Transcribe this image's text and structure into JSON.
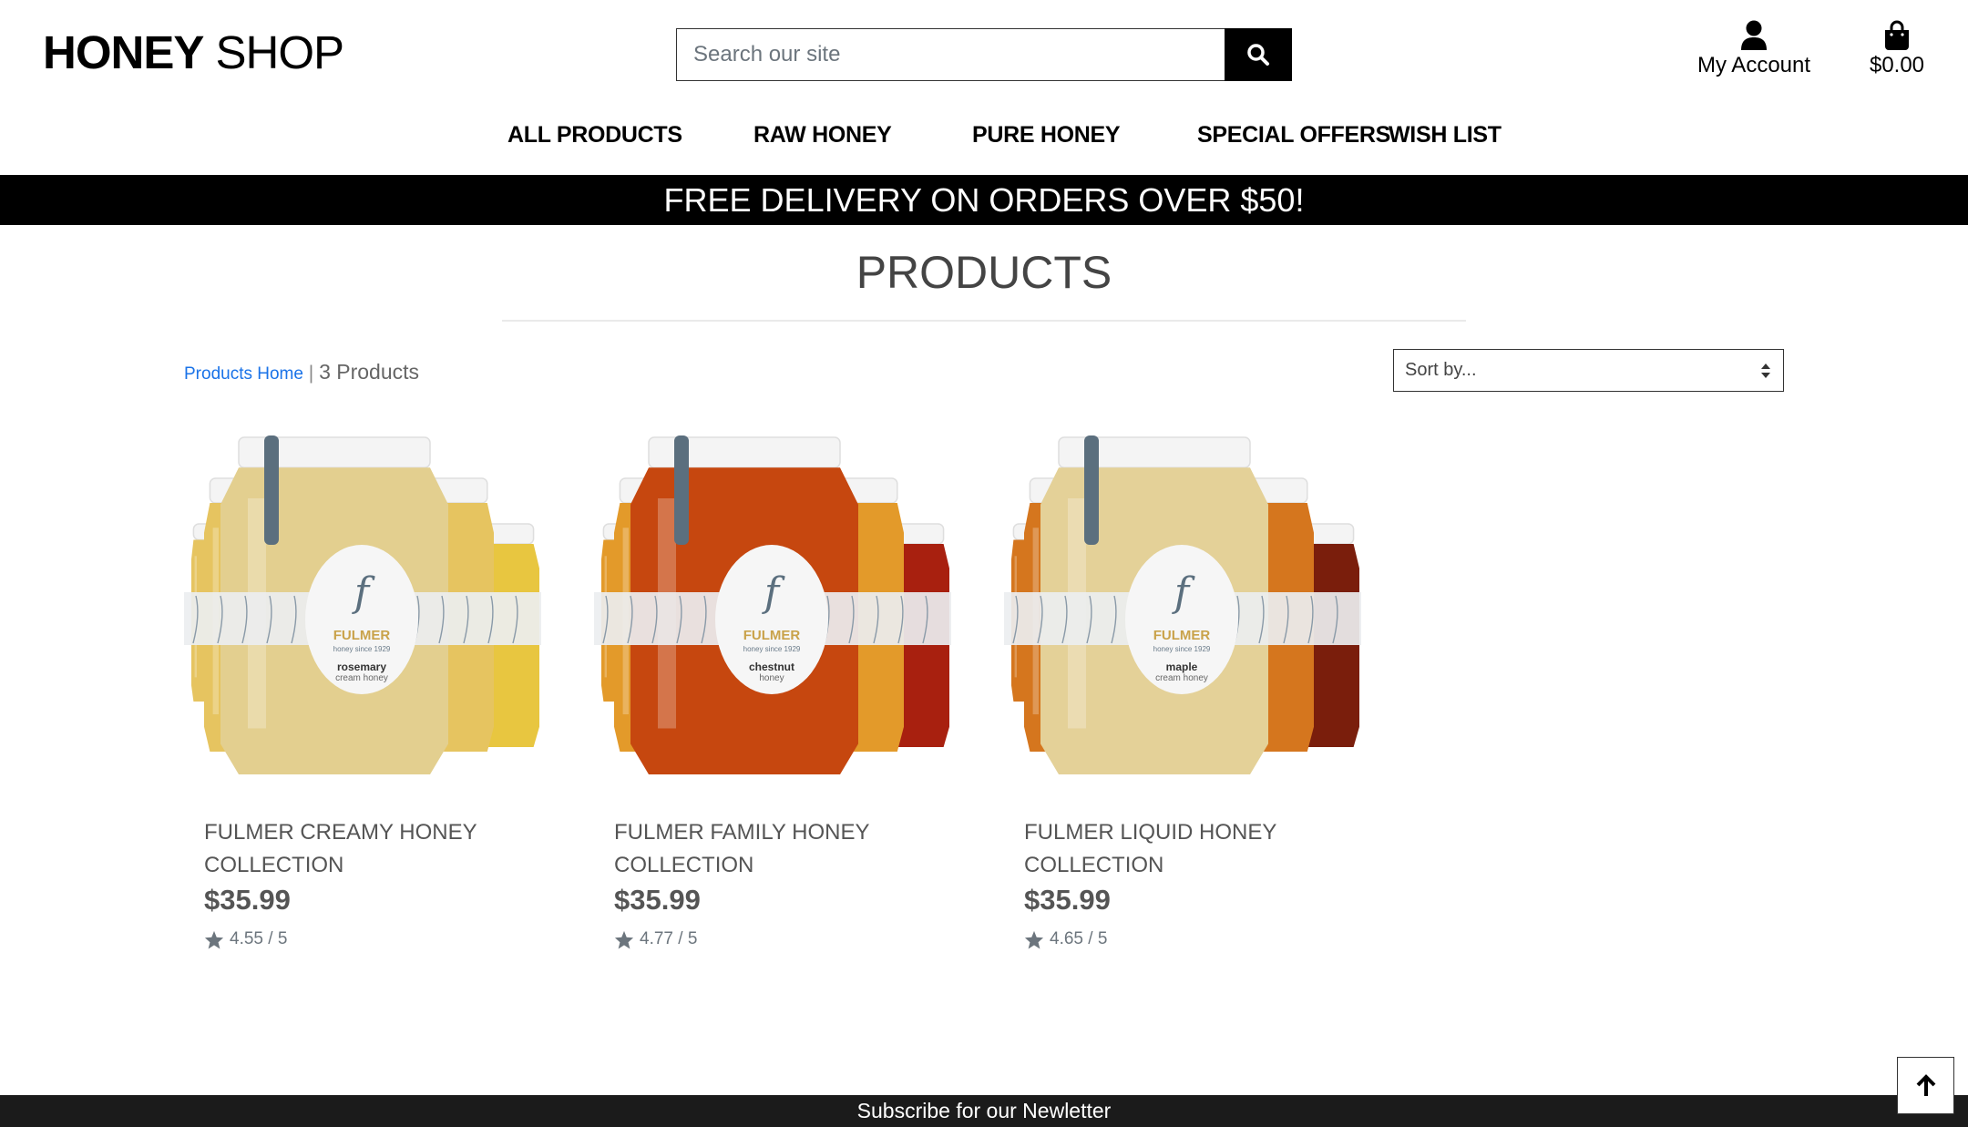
{
  "header": {
    "brand_bold": "HONEY",
    "brand_light": " SHOP",
    "search_placeholder": "Search our site",
    "account_label": "My Account",
    "cart_total": "$0.00"
  },
  "nav": {
    "items": [
      {
        "label": "ALL PRODUCTS"
      },
      {
        "label": "RAW HONEY"
      },
      {
        "label": "PURE HONEY"
      },
      {
        "label": "SPECIAL OFFERS"
      },
      {
        "label": "WISH LIST"
      }
    ]
  },
  "banner": "FREE DELIVERY ON ORDERS OVER $50!",
  "page_title": "PRODUCTS",
  "breadcrumb": {
    "home_link": "Products Home",
    "separator": " | ",
    "count": "3 Products"
  },
  "sort": {
    "selected": "Sort by..."
  },
  "products": [
    {
      "name": "FULMER CREAMY HONEY COLLECTION",
      "price": "$35.99",
      "rating": "4.55 / 5",
      "label_brand": "FULMER",
      "label_since": "honey since 1929",
      "label_flavor": "rosemary",
      "label_kind": "cream honey",
      "colors": {
        "main": "#e3cf8f",
        "side_left": "#e6c460",
        "side_right": "#e8c640"
      }
    },
    {
      "name": "FULMER FAMILY HONEY COLLECTION",
      "price": "$35.99",
      "rating": "4.77 / 5",
      "label_brand": "FULMER",
      "label_since": "honey since 1929",
      "label_flavor": "chestnut",
      "label_kind": "honey",
      "colors": {
        "main": "#c6470f",
        "side_left": "#e39a2a",
        "side_right": "#a8200f"
      }
    },
    {
      "name": "FULMER LIQUID HONEY COLLECTION",
      "price": "$35.99",
      "rating": "4.65 / 5",
      "label_brand": "FULMER",
      "label_since": "honey since 1929",
      "label_flavor": "maple",
      "label_kind": "cream honey",
      "colors": {
        "main": "#e4d198",
        "side_left": "#d5761e",
        "side_right": "#7a1e0c"
      }
    }
  ],
  "footer": {
    "newsletter": "Subscribe for our Newletter"
  }
}
